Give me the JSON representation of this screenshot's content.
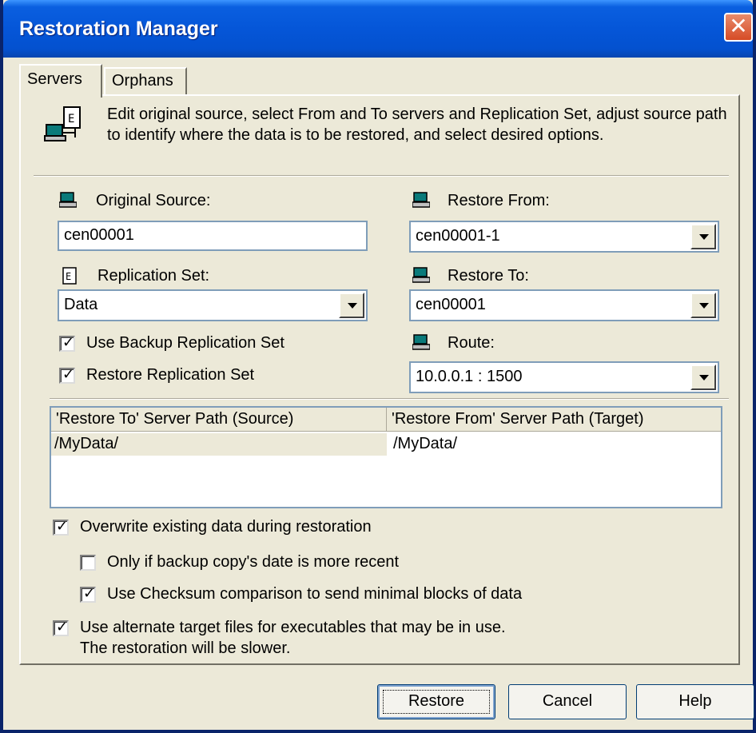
{
  "window": {
    "title": "Restoration Manager",
    "close_symbol": "✕"
  },
  "tabs": [
    {
      "label": "Servers"
    },
    {
      "label": "Orphans"
    }
  ],
  "description": "Edit original source, select From and To servers and Replication Set, adjust source path to identify where the data is to be restored, and select desired options.",
  "left": {
    "original_source_label": "Original Source:",
    "original_source_value": "cen00001",
    "replication_set_label": "Replication Set:",
    "replication_set_value": "Data",
    "use_backup_label": "Use Backup Replication Set",
    "use_backup_checked": true,
    "restore_set_label": "Restore Replication Set",
    "restore_set_checked": true
  },
  "right": {
    "restore_from_label": "Restore From:",
    "restore_from_value": "cen00001-1",
    "restore_to_label": "Restore To:",
    "restore_to_value": "cen00001",
    "route_label": "Route:",
    "route_value": "10.0.0.1 : 1500"
  },
  "paths_table": {
    "columns": [
      "'Restore To' Server Path (Source)",
      "'Restore From' Server Path (Target)"
    ],
    "rows": [
      [
        "/MyData/",
        "/MyData/"
      ]
    ]
  },
  "options": {
    "overwrite_label": "Overwrite existing data during restoration",
    "overwrite_checked": true,
    "only_recent_label": "Only if backup copy's date is more recent",
    "only_recent_checked": false,
    "checksum_label": "Use Checksum comparison to send minimal blocks of data",
    "checksum_checked": true,
    "alternate_label_line1": "Use alternate target files for executables that may be in use.",
    "alternate_label_line2": "The restoration will be slower.",
    "alternate_checked": true,
    "check_symbol": "✓"
  },
  "buttons": {
    "restore": "Restore",
    "cancel": "Cancel",
    "help": "Help"
  },
  "colors": {
    "titlebar": "#0556d8",
    "dialog_bg": "#ece9d8",
    "field_border": "#7f9db9"
  }
}
